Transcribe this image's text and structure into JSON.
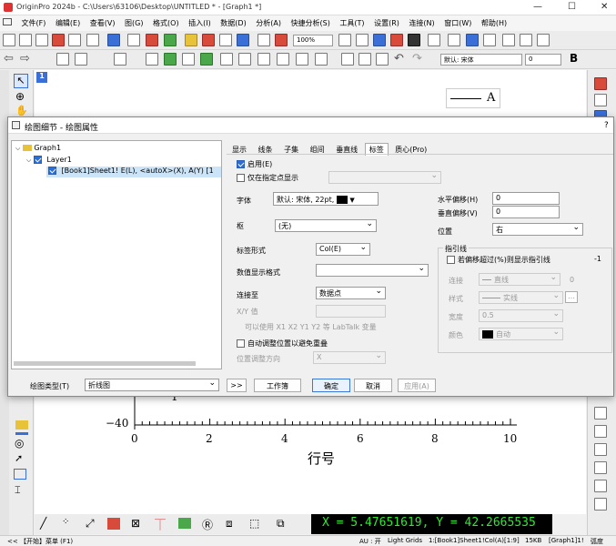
{
  "window": {
    "title": "OriginPro 2024b - C:\\Users\\63106\\Desktop\\UNTITLED * - [Graph1 *]",
    "min": "—",
    "max": "☐",
    "close": "✕"
  },
  "menu": [
    "文件(F)",
    "编辑(E)",
    "查看(V)",
    "图(G)",
    "格式(O)",
    "插入(I)",
    "数据(D)",
    "分析(A)",
    "快捷分析(S)",
    "工具(T)",
    "设置(R)",
    "连接(N)",
    "窗口(W)",
    "帮助(H)"
  ],
  "toolbar": {
    "zoom": "100%",
    "font_name": "默认: 宋体",
    "font_size": "0",
    "bold": "B"
  },
  "graph": {
    "layer_number": "1",
    "legend_label": "A",
    "ytick_bottom": "−40",
    "xticks": [
      "0",
      "2",
      "4",
      "6",
      "8",
      "10"
    ],
    "xlabel": "行号",
    "partial_tick": "1"
  },
  "dialog": {
    "title": "绘图细节 - 绘图属性",
    "help": "?",
    "tree": {
      "root": "Graph1",
      "layer": "Layer1",
      "plot": "[Book1]Sheet1! E(L), <autoX>(X), A(Y) [1"
    },
    "tabs": [
      "显示",
      "线条",
      "子集",
      "组间",
      "垂直线",
      "标签",
      "质心(Pro)"
    ],
    "active_tab": "标签",
    "enable": "启用(E)",
    "only_points": "仅在指定点显示",
    "font_label": "字体",
    "font_value": "默认: 宋体, 22pt,",
    "pivot_label": "枢",
    "pivot_value": "(无)",
    "label_form_label": "标签形式",
    "label_form_value": "Col(E)",
    "num_format_label": "数值显示格式",
    "connect_label": "连接至",
    "connect_value": "数据点",
    "xy_label": "X/Y 值",
    "xy_hint": "可以使用 X1 X2 Y1 Y2 等 LabTalk 变量",
    "auto_adjust": "自动调整位置以避免重叠",
    "adjust_dir_label": "位置调整方向",
    "adjust_dir_value": "X",
    "hoffset_label": "水平偏移(H)",
    "hoffset_value": "0",
    "voffset_label": "垂直偏移(V)",
    "voffset_value": "0",
    "position_label": "位置",
    "position_value": "右",
    "leader_title": "指引线",
    "leader_check": "若偏移超过(%)则显示指引线",
    "leader_pct": "-1",
    "leader_conn_label": "连接",
    "leader_conn_value": "直线",
    "leader_conn_num": "0",
    "leader_style_label": "样式",
    "leader_style_value": "实线",
    "leader_width_label": "宽度",
    "leader_width_value": "0.5",
    "leader_color_label": "颜色",
    "leader_color_value": "自动",
    "plot_type_label": "绘图类型(T)",
    "plot_type_value": "折线图",
    "arrows": ">>",
    "workbook": "工作簿",
    "ok": "确定",
    "cancel": "取消",
    "apply": "应用(A)"
  },
  "coord_readout": "X = 5.47651619, Y = 42.2665535",
  "status": {
    "start": "<< 【开始】菜单 (F1)",
    "au": "AU : 开",
    "grid": "Light Grids",
    "range": "1:[Book1]Sheet1!Col(A)[1:9]",
    "size": "15KB",
    "window": "[Graph1]1!",
    "unit": "弧度"
  },
  "colors": {
    "accent": "#2b6fd6",
    "coord_bg": "#000000",
    "coord_fg": "#2fe82f"
  }
}
